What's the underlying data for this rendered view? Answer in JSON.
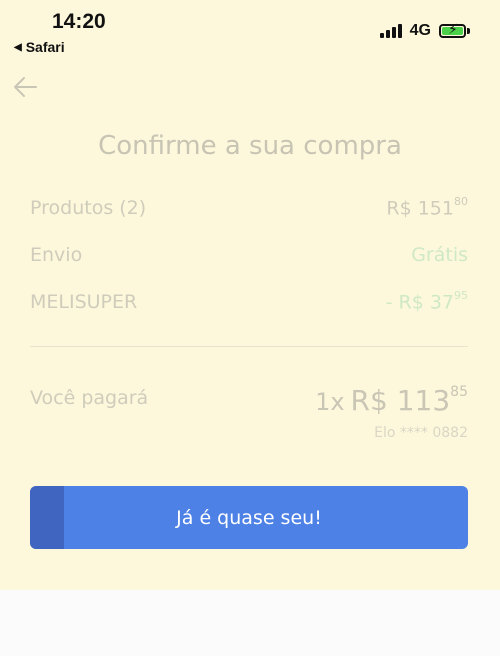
{
  "status_bar": {
    "time": "14:20",
    "back_app": "Safari",
    "network": "4G"
  },
  "icons": {
    "back": "arrow-left-icon",
    "signal": "cellular-signal-icon",
    "battery": "battery-charging-icon"
  },
  "page": {
    "title": "Confirme a sua compra"
  },
  "summary": {
    "products": {
      "label": "Produtos (2)",
      "amount": "R$ 151",
      "cents": "80"
    },
    "shipping": {
      "label": "Envio",
      "value": "Grátis"
    },
    "discount": {
      "label": "MELISUPER",
      "amount": "- R$ 37",
      "cents": "95"
    }
  },
  "total": {
    "label": "Você pagará",
    "installments": "1x",
    "amount": "R$ 113",
    "cents": "85",
    "card": "Elo **** 0882"
  },
  "cta": {
    "label": "Já é quase seu!"
  },
  "colors": {
    "background": "#fdf8db",
    "primary_button": "#4d81e6",
    "free_shipping": "#cfe8c6"
  }
}
